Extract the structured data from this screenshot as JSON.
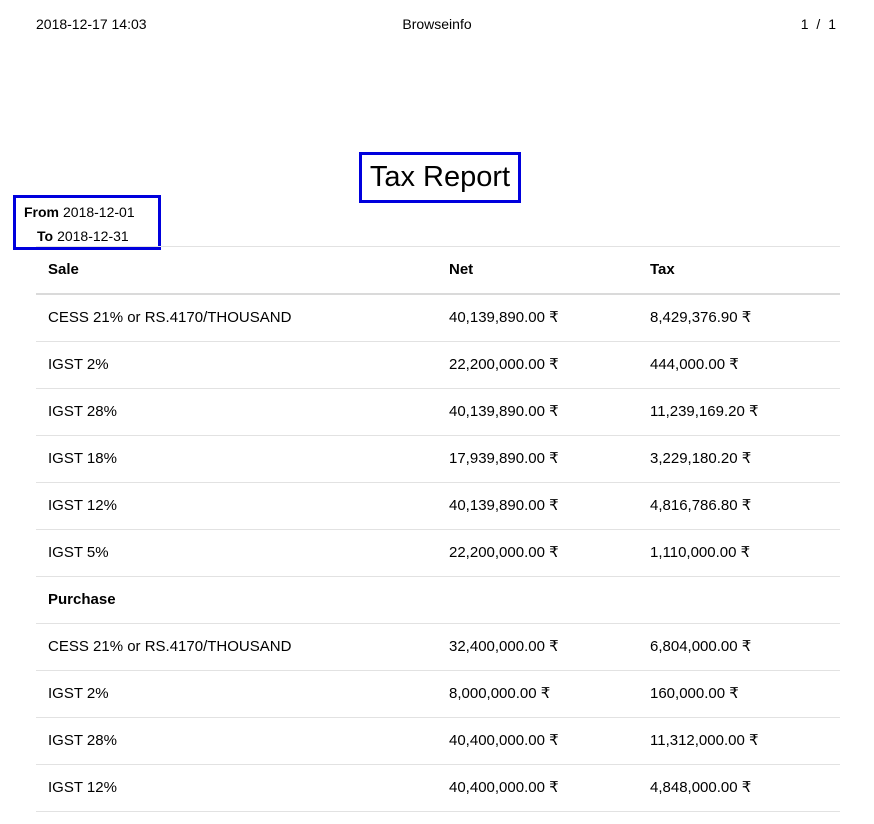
{
  "page_header": {
    "datetime": "2018-12-17 14:03",
    "title": "Browseinfo",
    "page_indicator": "1  /  1"
  },
  "report": {
    "title": "Tax Report",
    "from_label": "From",
    "from_date": "2018-12-01",
    "to_label": "To",
    "to_date": "2018-12-31"
  },
  "table": {
    "headers": [
      "Sale",
      "Net",
      "Tax"
    ],
    "sale_rows": [
      {
        "name": "CESS 21% or RS.4170/THOUSAND",
        "net": "40,139,890.00 ₹",
        "tax": "8,429,376.90 ₹"
      },
      {
        "name": "IGST 2%",
        "net": "22,200,000.00 ₹",
        "tax": "444,000.00 ₹"
      },
      {
        "name": "IGST 28%",
        "net": "40,139,890.00 ₹",
        "tax": "11,239,169.20 ₹"
      },
      {
        "name": "IGST 18%",
        "net": "17,939,890.00 ₹",
        "tax": "3,229,180.20 ₹"
      },
      {
        "name": "IGST 12%",
        "net": "40,139,890.00 ₹",
        "tax": "4,816,786.80 ₹"
      },
      {
        "name": "IGST 5%",
        "net": "22,200,000.00 ₹",
        "tax": "1,110,000.00 ₹"
      }
    ],
    "purchase_label": "Purchase",
    "purchase_rows": [
      {
        "name": "CESS 21% or RS.4170/THOUSAND",
        "net": "32,400,000.00 ₹",
        "tax": "6,804,000.00 ₹"
      },
      {
        "name": "IGST 2%",
        "net": "8,000,000.00 ₹",
        "tax": "160,000.00 ₹"
      },
      {
        "name": "IGST 28%",
        "net": "40,400,000.00 ₹",
        "tax": "11,312,000.00 ₹"
      },
      {
        "name": "IGST 12%",
        "net": "40,400,000.00 ₹",
        "tax": "4,848,000.00 ₹"
      }
    ]
  }
}
